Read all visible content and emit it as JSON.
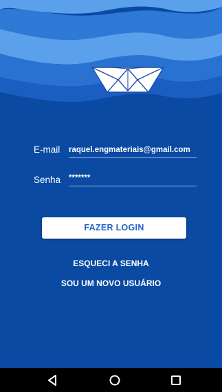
{
  "login": {
    "email_label": "E-mail",
    "email_value": "raquel.engmateriais@gmail.com",
    "password_label": "Senha",
    "password_value": "*******",
    "login_button": "FAZER LOGIN",
    "forgot_password": "ESQUECI A SENHA",
    "new_user": "SOU UM NOVO USUÁRIO"
  },
  "colors": {
    "background": "#0a4aa3",
    "wave_light": "#5aa0ea",
    "wave_mid": "#2e78d6",
    "wave_dark": "#1a5ec2",
    "button_text": "#2a62c9",
    "navbar": "#000000"
  },
  "icons": {
    "header": "paper-boat-icon",
    "nav_back": "back-triangle-icon",
    "nav_home": "home-circle-icon",
    "nav_recents": "recents-square-icon"
  }
}
